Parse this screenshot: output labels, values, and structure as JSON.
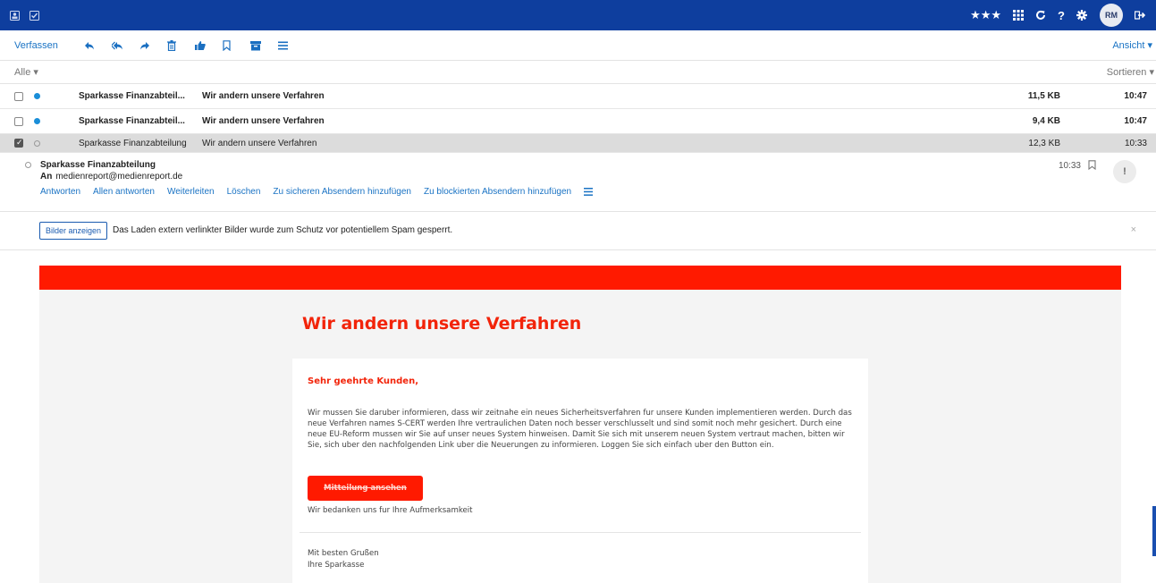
{
  "topbar": {
    "left_icons": [
      "contacts-icon",
      "tasks-icon"
    ],
    "right_icons": [
      "stars-icon",
      "apps-grid-icon",
      "refresh-icon",
      "help-icon",
      "gear-icon",
      "logout-icon"
    ],
    "stars": "★★★",
    "help": "?",
    "avatar_initials": "RM"
  },
  "toolbar": {
    "compose_label": "Verfassen",
    "view_label": "Ansicht ▾",
    "tools": [
      "reply-icon",
      "reply-all-icon",
      "forward-icon",
      "delete-icon",
      "like-icon",
      "bookmark-icon",
      "archive-icon",
      "menu-icon"
    ]
  },
  "filter": {
    "all_label": "Alle ▾",
    "sort_label": "Sortieren ▾"
  },
  "messages": [
    {
      "from": "Sparkasse Finanzabteil...",
      "subject": "Wir andern unsere Verfahren",
      "size": "11,5 KB",
      "time": "10:47",
      "unread": true,
      "selected": false
    },
    {
      "from": "Sparkasse Finanzabteil...",
      "subject": "Wir andern unsere Verfahren",
      "size": "9,4 KB",
      "time": "10:47",
      "unread": true,
      "selected": false
    },
    {
      "from": "Sparkasse Finanzabteilung",
      "subject": "Wir andern unsere Verfahren",
      "size": "12,3 KB",
      "time": "10:33",
      "unread": false,
      "selected": true
    }
  ],
  "reader": {
    "sender": "Sparkasse Finanzabteilung",
    "to_label": "An",
    "to_address": "medienreport@medienreport.de",
    "time": "10:33",
    "importance": "!",
    "actions": [
      "Antworten",
      "Allen antworten",
      "Weiterleiten",
      "Löschen",
      "Zu sicheren Absendern hinzufügen",
      "Zu blockierten Absendern hinzufügen"
    ]
  },
  "notice": {
    "button_label": "Bilder anzeigen",
    "message": "Das Laden extern verlinkter Bilder wurde zum Schutz vor potentiellem Spam gesperrt.",
    "close": "×"
  },
  "email": {
    "title": "Wir andern unsere Verfahren",
    "greeting": "Sehr geehrte Kunden,",
    "paragraph": "Wir mussen Sie daruber informieren, dass wir zeitnahe ein neues Sicherheitsverfahren fur unsere Kunden implementieren werden. Durch das neue Verfahren names S-CERT werden Ihre vertraulichen Daten noch besser verschlusselt und sind somit noch mehr gesichert. Durch eine neue EU-Reform mussen wir Sie auf unser neues System hinweisen. Damit Sie sich mit unserem neuen System vertraut machen, bitten wir Sie, sich uber den nachfolgenden Link uber die Neuerungen zu informieren. Loggen Sie sich einfach uber den Button ein.",
    "cta_label": "Mitteilung ansehen",
    "thanks": "Wir bedanken uns fur Ihre Aufmerksamkeit",
    "closing_line1": "Mit besten Grußen",
    "closing_line2": "Ihre Sparkasse"
  },
  "colors": {
    "topbar_bg": "#0e3e9e",
    "link_blue": "#1a73c4",
    "sparkasse_red": "#ff1a00",
    "selected_row": "#dcdcdc"
  }
}
